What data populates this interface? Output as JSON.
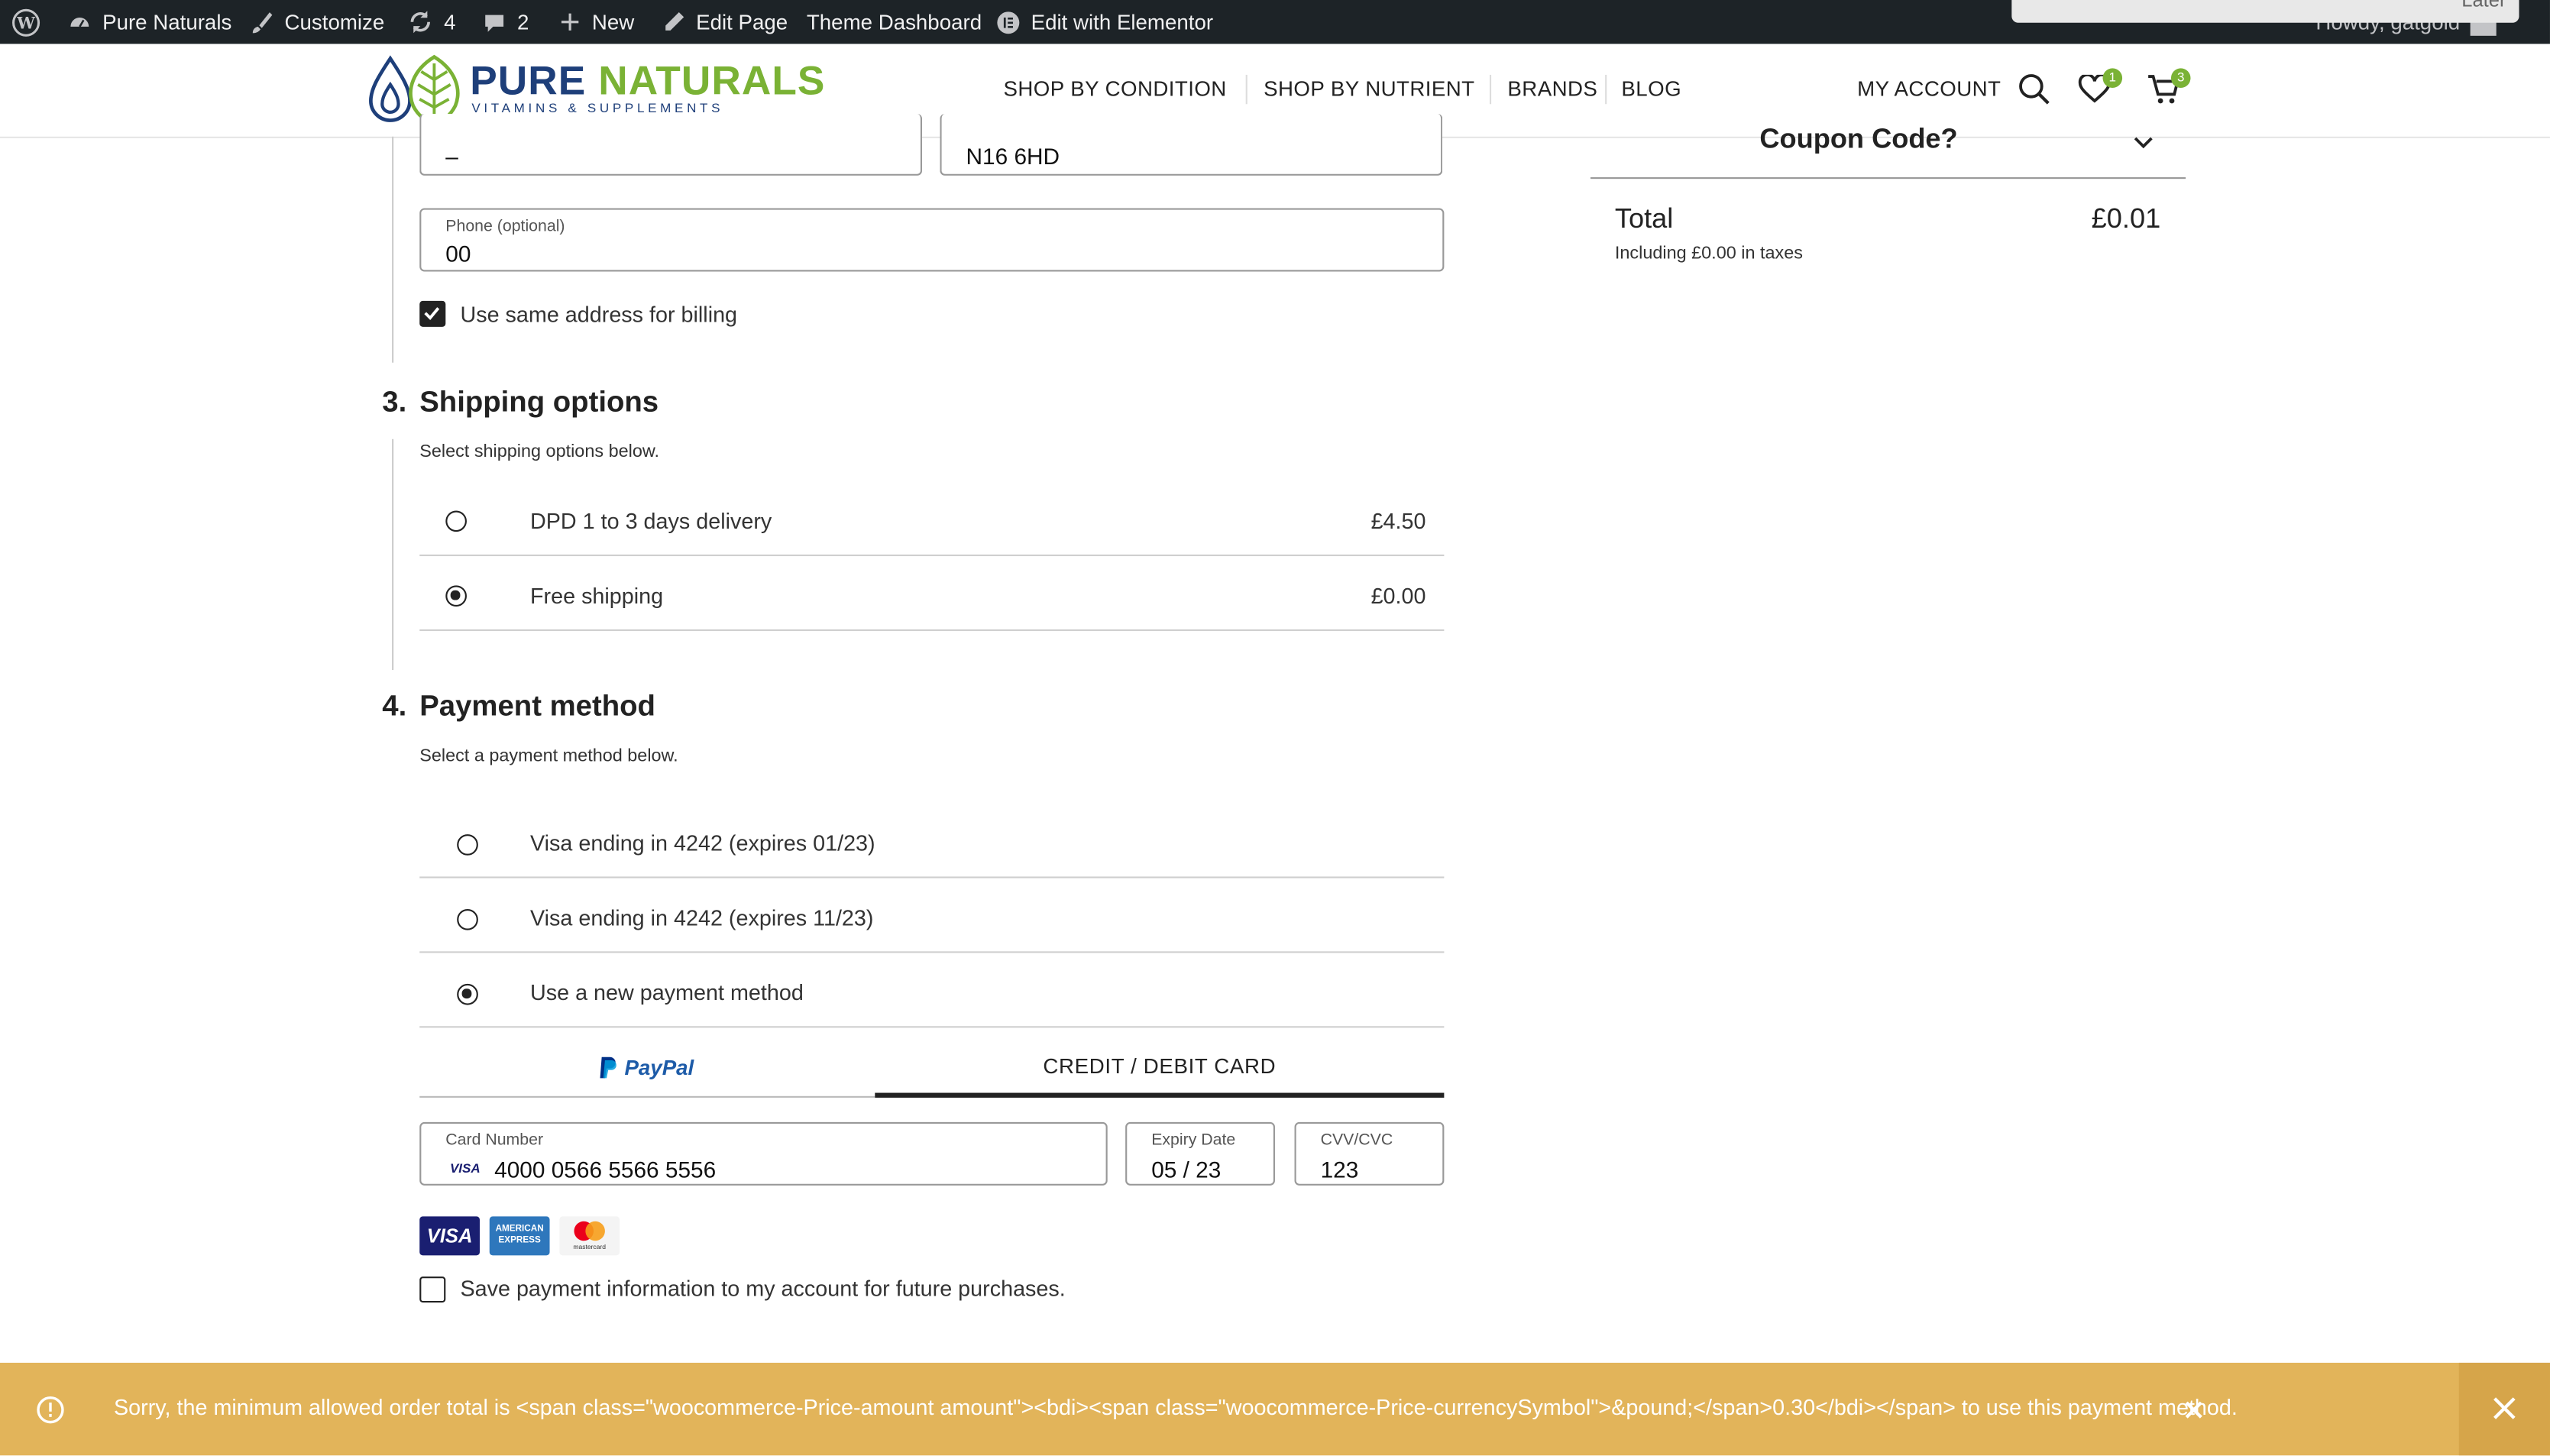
{
  "admin_bar": {
    "site_name": "Pure Naturals",
    "customize": "Customize",
    "updates_count": "4",
    "comments_count": "2",
    "new": "New",
    "edit_page": "Edit Page",
    "theme_dashboard": "Theme Dashboard",
    "edit_with_elementor": "Edit with Elementor",
    "howdy": "Howdy, gatgold",
    "later": "Later"
  },
  "header": {
    "logo_pure": "PURE",
    "logo_naturals": "NATURALS",
    "logo_sub": "VITAMINS & SUPPLEMENTS",
    "nav": [
      "SHOP BY CONDITION",
      "SHOP BY NUTRIENT",
      "BRANDS",
      "BLOG"
    ],
    "my_account": "MY ACCOUNT",
    "wishlist_count": "1",
    "cart_count": "3"
  },
  "address": {
    "field_left_value": "–",
    "postcode_value": "N16 6HD",
    "phone_label": "Phone (optional)",
    "phone_value": "00",
    "same_billing_label": "Use same address for billing"
  },
  "shipping": {
    "step_number": "3.",
    "title": "Shipping options",
    "subtitle": "Select shipping options below.",
    "options": [
      {
        "label": "DPD 1 to 3 days delivery",
        "price": "£4.50",
        "selected": false
      },
      {
        "label": "Free shipping",
        "price": "£0.00",
        "selected": true
      }
    ]
  },
  "payment": {
    "step_number": "4.",
    "title": "Payment method",
    "subtitle": "Select a payment method below.",
    "methods": [
      {
        "label": "Visa ending in 4242 (expires 01/23)",
        "selected": false
      },
      {
        "label": "Visa ending in 4242 (expires 11/23)",
        "selected": false
      },
      {
        "label": "Use a new payment method",
        "selected": true
      }
    ],
    "tab_paypal": "PayPal",
    "tab_card": "CREDIT / DEBIT CARD",
    "card_number_label": "Card Number",
    "card_number_value": "4000 0566 5566 5556",
    "card_brand": "VISA",
    "expiry_label": "Expiry Date",
    "expiry_value": "05 / 23",
    "cvv_label": "CVV/CVC",
    "cvv_value": "123",
    "logo_visa": "VISA",
    "logo_amex": "AMERICAN EXPRESS",
    "logo_mastercard": "mastercard",
    "save_label": "Save payment information to my account for future purchases."
  },
  "summary": {
    "coupon": "Coupon Code?",
    "total_label": "Total",
    "total_value": "£0.01",
    "taxes": "Including £0.00 in taxes"
  },
  "notice": {
    "message": "Sorry, the minimum allowed order total is <span class=\"woocommerce-Price-amount amount\"><bdi><span class=\"woocommerce-Price-currencySymbol\">&pound;</span>0.30</bdi></span> to use this payment method."
  },
  "colors": {
    "admin_bar": "#1d2327",
    "brand_blue": "#1e3f7a",
    "brand_green": "#7ab235",
    "notice_bg": "#e2b45a"
  }
}
